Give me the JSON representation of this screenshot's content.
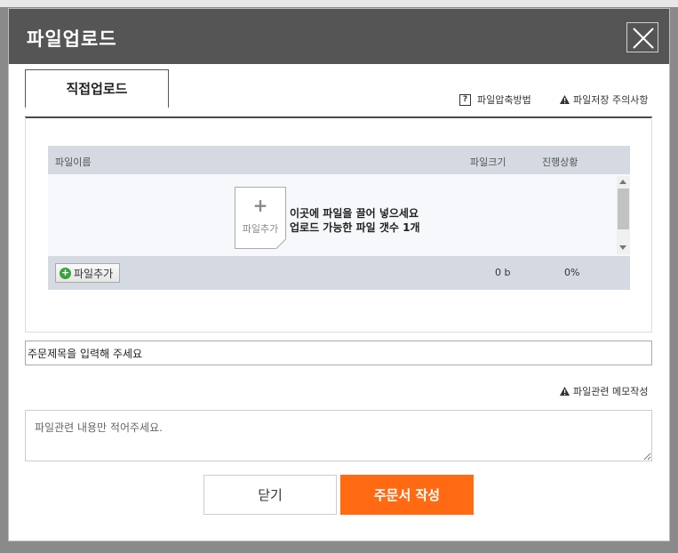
{
  "modal": {
    "title": "파일업로드",
    "close_icon": "close-icon"
  },
  "tabs": {
    "active_label": "직접업로드",
    "compress_help": "파일압축방법",
    "storage_notice": "파일저장 주의사항"
  },
  "table": {
    "columns": {
      "name": "파일이름",
      "size": "파일크기",
      "progress": "진행상황"
    },
    "drop_zone": {
      "icon_label": "파일추가",
      "line1": "이곳에 파일을 끌어 넣으세요",
      "line2": "업로드 가능한 파일 갯수 1개"
    },
    "footer": {
      "add_button": "파일추가",
      "total_size": "0 b",
      "total_progress": "0%"
    }
  },
  "order": {
    "title_value": "주문제목을 입력해 주세요"
  },
  "memo": {
    "label": "파일관련 메모작성",
    "placeholder": "파일관련 내용만 적어주세요."
  },
  "buttons": {
    "close": "닫기",
    "submit": "주문서 작성"
  },
  "colors": {
    "header_bg": "#555555",
    "accent": "#ff6a13",
    "table_head_bg": "#d5dae2"
  }
}
